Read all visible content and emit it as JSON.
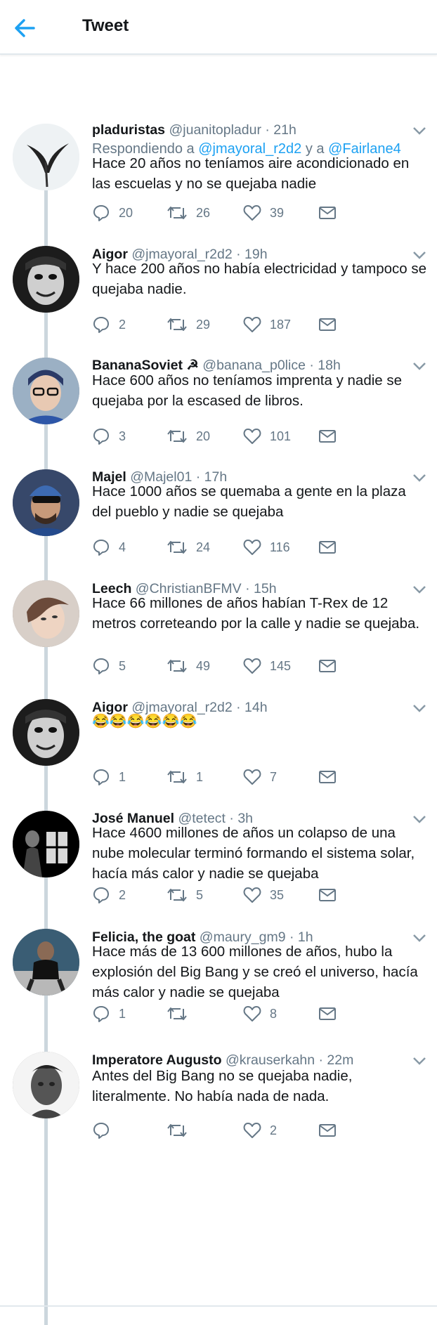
{
  "header": {
    "title": "Tweet"
  },
  "tweets": [
    {
      "name": "pladuristas",
      "handle": "@juanitopladur",
      "time": "21h",
      "reply_prefix": "Respondiendo a ",
      "reply_user1": "@jmayoral_r2d2",
      "reply_and": " y a ",
      "reply_user2": "@Fairlane4",
      "text": "Hace 20 años no teníamos aire acondicionado en las escuelas y no se quejaba nadie",
      "replies": "20",
      "retweets": "26",
      "likes": "39"
    },
    {
      "name": "Aigor",
      "handle": "@jmayoral_r2d2",
      "time": "19h",
      "text": "Y hace 200 años no había electricidad y tampoco se quejaba nadie.",
      "replies": "2",
      "retweets": "29",
      "likes": "187"
    },
    {
      "name": "BananaSoviet ☭",
      "handle": "@banana_p0lice",
      "time": "18h",
      "text": "Hace 600 años no teníamos imprenta y nadie se quejaba por la escased de libros.",
      "replies": "3",
      "retweets": "20",
      "likes": "101"
    },
    {
      "name": "Majel",
      "handle": "@Majel01",
      "time": "17h",
      "text": "Hace 1000 años se quemaba a gente en la plaza del pueblo y nadie se quejaba",
      "replies": "4",
      "retweets": "24",
      "likes": "116"
    },
    {
      "name": "Leech",
      "handle": "@ChristianBFMV",
      "time": "15h",
      "text": "Hace 66 millones de años habían T-Rex de 12 metros correteando por la calle y nadie se quejaba.",
      "replies": "5",
      "retweets": "49",
      "likes": "145"
    },
    {
      "name": "Aigor",
      "handle": "@jmayoral_r2d2",
      "time": "14h",
      "text": "😂😂😂😂😂😂",
      "replies": "1",
      "retweets": "1",
      "likes": "7"
    },
    {
      "name": "José Manuel",
      "handle": "@tetect",
      "time": "3h",
      "text": "Hace 4600 millones de años un colapso de una nube molecular terminó formando el sistema solar, hacía más calor y nadie se quejaba",
      "replies": "2",
      "retweets": "5",
      "likes": "35"
    },
    {
      "name": "Felicia, the goat",
      "handle": "@maury_gm9",
      "time": "1h",
      "text": "Hace más de 13 600 millones de años, hubo la explosión del Big Bang y se creó el universo, hacía más calor y nadie se quejaba",
      "replies": "1",
      "retweets": "",
      "likes": "8"
    },
    {
      "name": "Imperatore Augusto",
      "handle": "@krauserkahn",
      "time": "22m",
      "text": "Antes del Big Bang no se quejaba nadie, literalmente. No había nada de nada.",
      "replies": "",
      "retweets": "",
      "likes": "2"
    }
  ],
  "ui": {
    "separator": "·",
    "icons": [
      "back-arrow-icon",
      "chevron-down-icon",
      "reply-icon",
      "retweet-icon",
      "like-icon",
      "dm-icon"
    ],
    "accent_color": "#1da1f2",
    "muted_color": "#657786",
    "thread_line_color": "#ccd6dd"
  }
}
